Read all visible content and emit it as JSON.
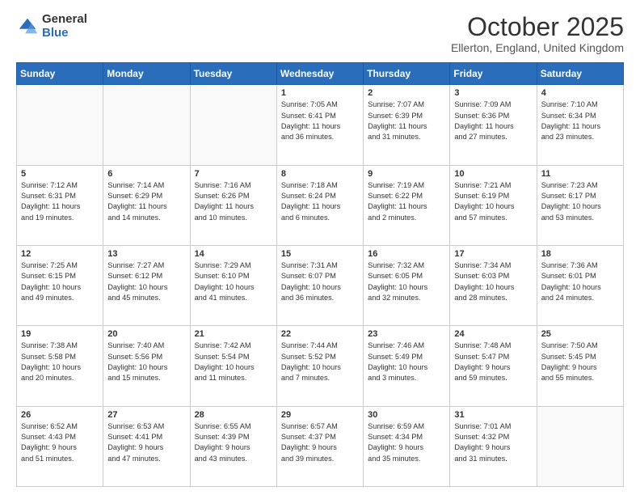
{
  "logo": {
    "general": "General",
    "blue": "Blue"
  },
  "title": "October 2025",
  "location": "Ellerton, England, United Kingdom",
  "weekdays": [
    "Sunday",
    "Monday",
    "Tuesday",
    "Wednesday",
    "Thursday",
    "Friday",
    "Saturday"
  ],
  "weeks": [
    [
      {
        "day": "",
        "info": ""
      },
      {
        "day": "",
        "info": ""
      },
      {
        "day": "",
        "info": ""
      },
      {
        "day": "1",
        "info": "Sunrise: 7:05 AM\nSunset: 6:41 PM\nDaylight: 11 hours\nand 36 minutes."
      },
      {
        "day": "2",
        "info": "Sunrise: 7:07 AM\nSunset: 6:39 PM\nDaylight: 11 hours\nand 31 minutes."
      },
      {
        "day": "3",
        "info": "Sunrise: 7:09 AM\nSunset: 6:36 PM\nDaylight: 11 hours\nand 27 minutes."
      },
      {
        "day": "4",
        "info": "Sunrise: 7:10 AM\nSunset: 6:34 PM\nDaylight: 11 hours\nand 23 minutes."
      }
    ],
    [
      {
        "day": "5",
        "info": "Sunrise: 7:12 AM\nSunset: 6:31 PM\nDaylight: 11 hours\nand 19 minutes."
      },
      {
        "day": "6",
        "info": "Sunrise: 7:14 AM\nSunset: 6:29 PM\nDaylight: 11 hours\nand 14 minutes."
      },
      {
        "day": "7",
        "info": "Sunrise: 7:16 AM\nSunset: 6:26 PM\nDaylight: 11 hours\nand 10 minutes."
      },
      {
        "day": "8",
        "info": "Sunrise: 7:18 AM\nSunset: 6:24 PM\nDaylight: 11 hours\nand 6 minutes."
      },
      {
        "day": "9",
        "info": "Sunrise: 7:19 AM\nSunset: 6:22 PM\nDaylight: 11 hours\nand 2 minutes."
      },
      {
        "day": "10",
        "info": "Sunrise: 7:21 AM\nSunset: 6:19 PM\nDaylight: 10 hours\nand 57 minutes."
      },
      {
        "day": "11",
        "info": "Sunrise: 7:23 AM\nSunset: 6:17 PM\nDaylight: 10 hours\nand 53 minutes."
      }
    ],
    [
      {
        "day": "12",
        "info": "Sunrise: 7:25 AM\nSunset: 6:15 PM\nDaylight: 10 hours\nand 49 minutes."
      },
      {
        "day": "13",
        "info": "Sunrise: 7:27 AM\nSunset: 6:12 PM\nDaylight: 10 hours\nand 45 minutes."
      },
      {
        "day": "14",
        "info": "Sunrise: 7:29 AM\nSunset: 6:10 PM\nDaylight: 10 hours\nand 41 minutes."
      },
      {
        "day": "15",
        "info": "Sunrise: 7:31 AM\nSunset: 6:07 PM\nDaylight: 10 hours\nand 36 minutes."
      },
      {
        "day": "16",
        "info": "Sunrise: 7:32 AM\nSunset: 6:05 PM\nDaylight: 10 hours\nand 32 minutes."
      },
      {
        "day": "17",
        "info": "Sunrise: 7:34 AM\nSunset: 6:03 PM\nDaylight: 10 hours\nand 28 minutes."
      },
      {
        "day": "18",
        "info": "Sunrise: 7:36 AM\nSunset: 6:01 PM\nDaylight: 10 hours\nand 24 minutes."
      }
    ],
    [
      {
        "day": "19",
        "info": "Sunrise: 7:38 AM\nSunset: 5:58 PM\nDaylight: 10 hours\nand 20 minutes."
      },
      {
        "day": "20",
        "info": "Sunrise: 7:40 AM\nSunset: 5:56 PM\nDaylight: 10 hours\nand 15 minutes."
      },
      {
        "day": "21",
        "info": "Sunrise: 7:42 AM\nSunset: 5:54 PM\nDaylight: 10 hours\nand 11 minutes."
      },
      {
        "day": "22",
        "info": "Sunrise: 7:44 AM\nSunset: 5:52 PM\nDaylight: 10 hours\nand 7 minutes."
      },
      {
        "day": "23",
        "info": "Sunrise: 7:46 AM\nSunset: 5:49 PM\nDaylight: 10 hours\nand 3 minutes."
      },
      {
        "day": "24",
        "info": "Sunrise: 7:48 AM\nSunset: 5:47 PM\nDaylight: 9 hours\nand 59 minutes."
      },
      {
        "day": "25",
        "info": "Sunrise: 7:50 AM\nSunset: 5:45 PM\nDaylight: 9 hours\nand 55 minutes."
      }
    ],
    [
      {
        "day": "26",
        "info": "Sunrise: 6:52 AM\nSunset: 4:43 PM\nDaylight: 9 hours\nand 51 minutes."
      },
      {
        "day": "27",
        "info": "Sunrise: 6:53 AM\nSunset: 4:41 PM\nDaylight: 9 hours\nand 47 minutes."
      },
      {
        "day": "28",
        "info": "Sunrise: 6:55 AM\nSunset: 4:39 PM\nDaylight: 9 hours\nand 43 minutes."
      },
      {
        "day": "29",
        "info": "Sunrise: 6:57 AM\nSunset: 4:37 PM\nDaylight: 9 hours\nand 39 minutes."
      },
      {
        "day": "30",
        "info": "Sunrise: 6:59 AM\nSunset: 4:34 PM\nDaylight: 9 hours\nand 35 minutes."
      },
      {
        "day": "31",
        "info": "Sunrise: 7:01 AM\nSunset: 4:32 PM\nDaylight: 9 hours\nand 31 minutes."
      },
      {
        "day": "",
        "info": ""
      }
    ]
  ]
}
